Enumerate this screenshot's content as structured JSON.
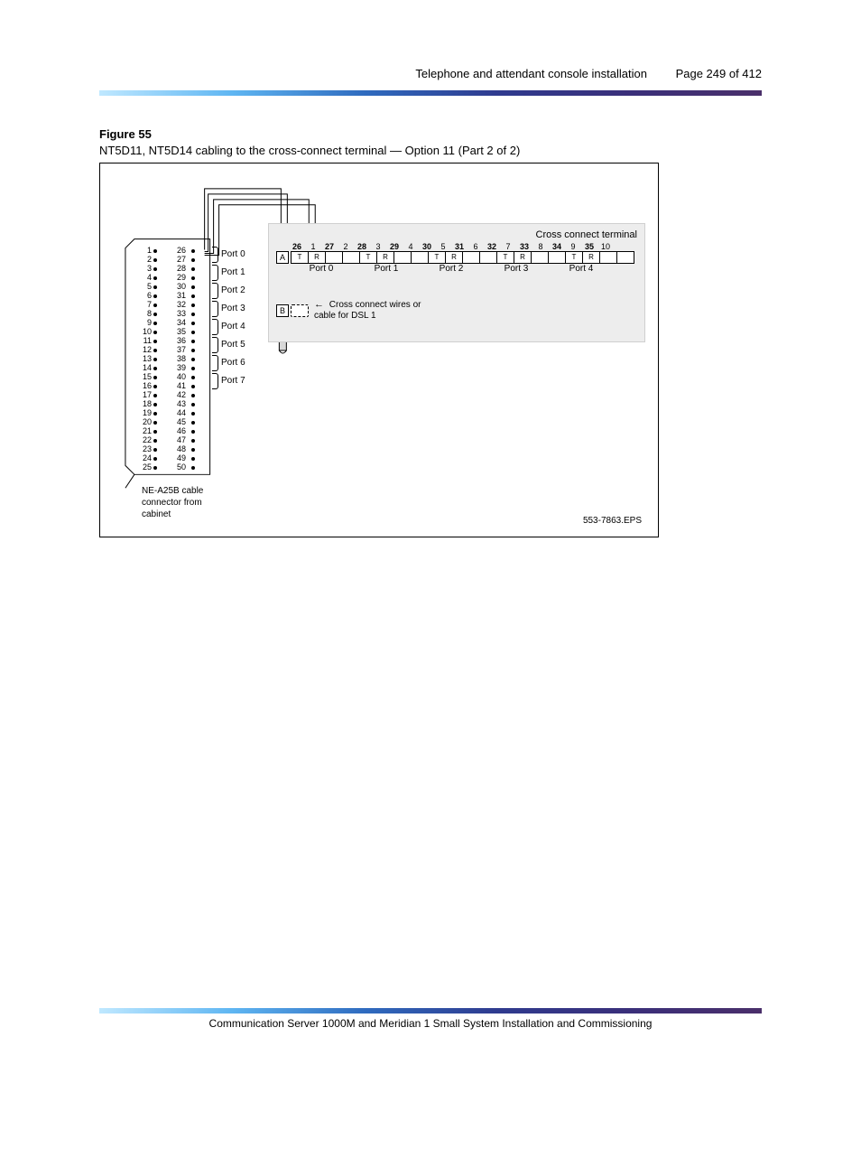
{
  "header": {
    "section": "Telephone and attendant console installation",
    "page_label": "Page 249 of 412"
  },
  "figure": {
    "id": "Figure 55",
    "caption": "NT5D11, NT5D14 cabling to the cross-connect terminal — Option 11 (Part 2 of 2)",
    "cc_title": "Cross connect terminal",
    "cable_label": "NE-A25B cable\nconnector from\ncabinet",
    "cc_pins_top": [
      "26",
      "1",
      "27",
      "2",
      "28",
      "3",
      "29",
      "4",
      "30",
      "5",
      "31",
      "6",
      "32",
      "7",
      "33",
      "8",
      "34",
      "9",
      "35",
      "10"
    ],
    "cc_pins_bold": [
      true,
      false,
      true,
      false,
      true,
      false,
      true,
      false,
      true,
      false,
      true,
      false,
      true,
      false,
      true,
      false,
      true,
      false,
      true,
      false
    ],
    "cc_rowA_label": "A",
    "cc_rowA_cells": [
      "T",
      "R",
      "",
      "",
      "T",
      "R",
      "",
      "",
      "T",
      "R",
      "",
      "",
      "T",
      "R",
      "",
      "",
      "T",
      "R",
      "",
      ""
    ],
    "cc_port_names": [
      "Port  0",
      "Port  1",
      "Port  2",
      "Port  3",
      "Port  4"
    ],
    "cc_rowB_label": "B",
    "cc_note": "Cross connect wires or\ncable for DSL 1",
    "port_labels": [
      "Port 0",
      "Port 1",
      "Port 2",
      "Port 3",
      "Port 4",
      "Port 5",
      "Port 6",
      "Port 7"
    ],
    "pins_left": [
      "1",
      "2",
      "3",
      "4",
      "5",
      "6",
      "7",
      "8",
      "9",
      "10",
      "11",
      "12",
      "13",
      "14",
      "15",
      "16",
      "17",
      "18",
      "19",
      "20",
      "21",
      "22",
      "23",
      "24",
      "25"
    ],
    "pins_right": [
      "26",
      "27",
      "28",
      "29",
      "30",
      "31",
      "32",
      "33",
      "34",
      "35",
      "36",
      "37",
      "38",
      "39",
      "40",
      "41",
      "42",
      "43",
      "44",
      "45",
      "46",
      "47",
      "48",
      "49",
      "50"
    ],
    "eps_id": "553-7863.EPS"
  },
  "footer": {
    "doc": "Communication Server 1000M and Meridian 1  Small System Installation and Commissioning"
  }
}
